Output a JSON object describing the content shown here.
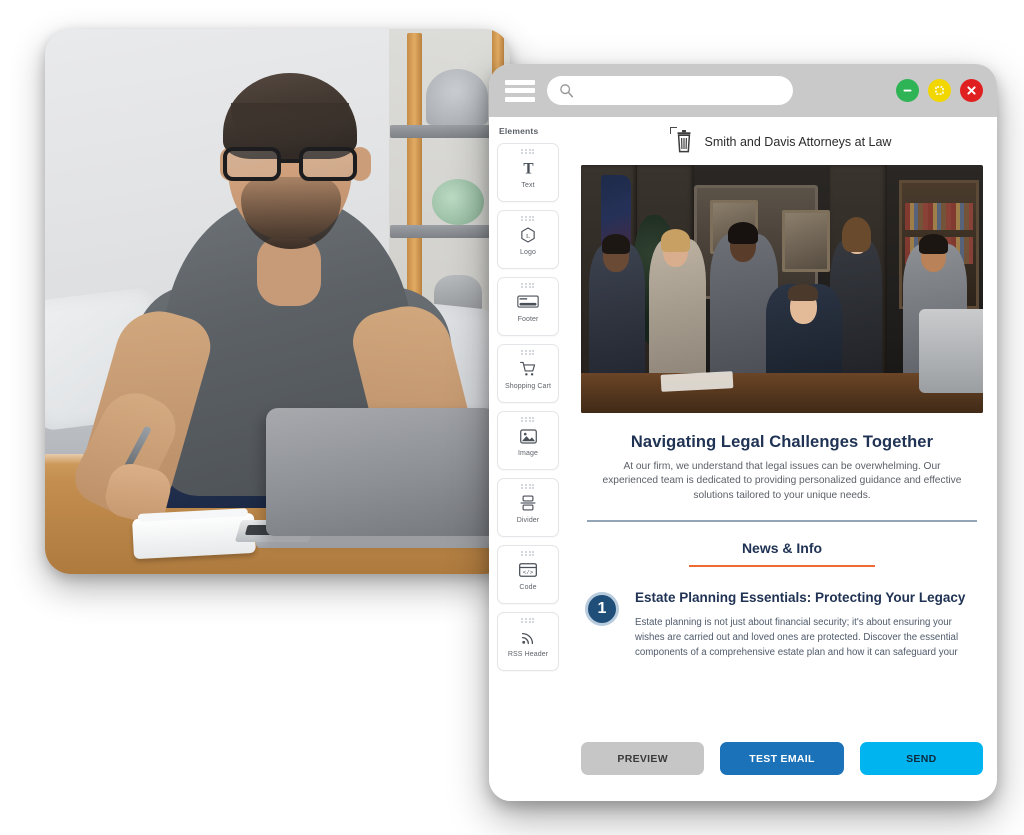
{
  "window": {
    "titlebar": {
      "menu_icon": "hamburger-menu-icon",
      "search": {
        "value": "",
        "placeholder": "",
        "icon": "search-icon"
      },
      "controls": [
        {
          "name": "minimize",
          "icon": "minus-icon",
          "color": "#2eb355"
        },
        {
          "name": "maximize",
          "icon": "square-icon",
          "color": "#f2d600"
        },
        {
          "name": "close",
          "icon": "close-x-icon",
          "color": "#e02020"
        }
      ]
    }
  },
  "sidebar": {
    "title": "Elements",
    "items": [
      {
        "label": "Text",
        "icon": "text-t-icon"
      },
      {
        "label": "Logo",
        "icon": "logo-hexagon-icon"
      },
      {
        "label": "Footer",
        "icon": "footer-icon"
      },
      {
        "label": "Shopping Cart",
        "icon": "shopping-cart-icon"
      },
      {
        "label": "Image",
        "icon": "image-icon"
      },
      {
        "label": "Divider",
        "icon": "divider-icon"
      },
      {
        "label": "Code",
        "icon": "code-brackets-icon"
      },
      {
        "label": "RSS Header",
        "icon": "rss-feed-icon"
      }
    ]
  },
  "email": {
    "firm_name": "Smith and Davis Attorneys at Law",
    "delete_icon": "trash-icon",
    "hero_image_alt": "law firm team portrait in office",
    "headline": "Navigating Legal Challenges Together",
    "subcopy": "At our firm, we understand that legal issues can be overwhelming. Our experienced team is dedicated to providing personalized guidance and effective solutions tailored to your unique needs.",
    "section_tab": "News & Info",
    "articles": [
      {
        "number": "1",
        "title": "Estate Planning Essentials: Protecting Your Legacy",
        "text": "Estate planning is not just about financial security; it's about ensuring your wishes are carried out and loved ones are protected. Discover the essential components of a comprehensive estate plan and how it can safeguard your"
      }
    ]
  },
  "actions": {
    "preview": "PREVIEW",
    "test_email": "TEST EMAIL",
    "send": "SEND"
  },
  "colors": {
    "accent_orange": "#ef6a32",
    "navy": "#203354",
    "send_cyan": "#00b4f0",
    "test_blue": "#1b72b8",
    "preview_gray": "#c6c6c6"
  }
}
